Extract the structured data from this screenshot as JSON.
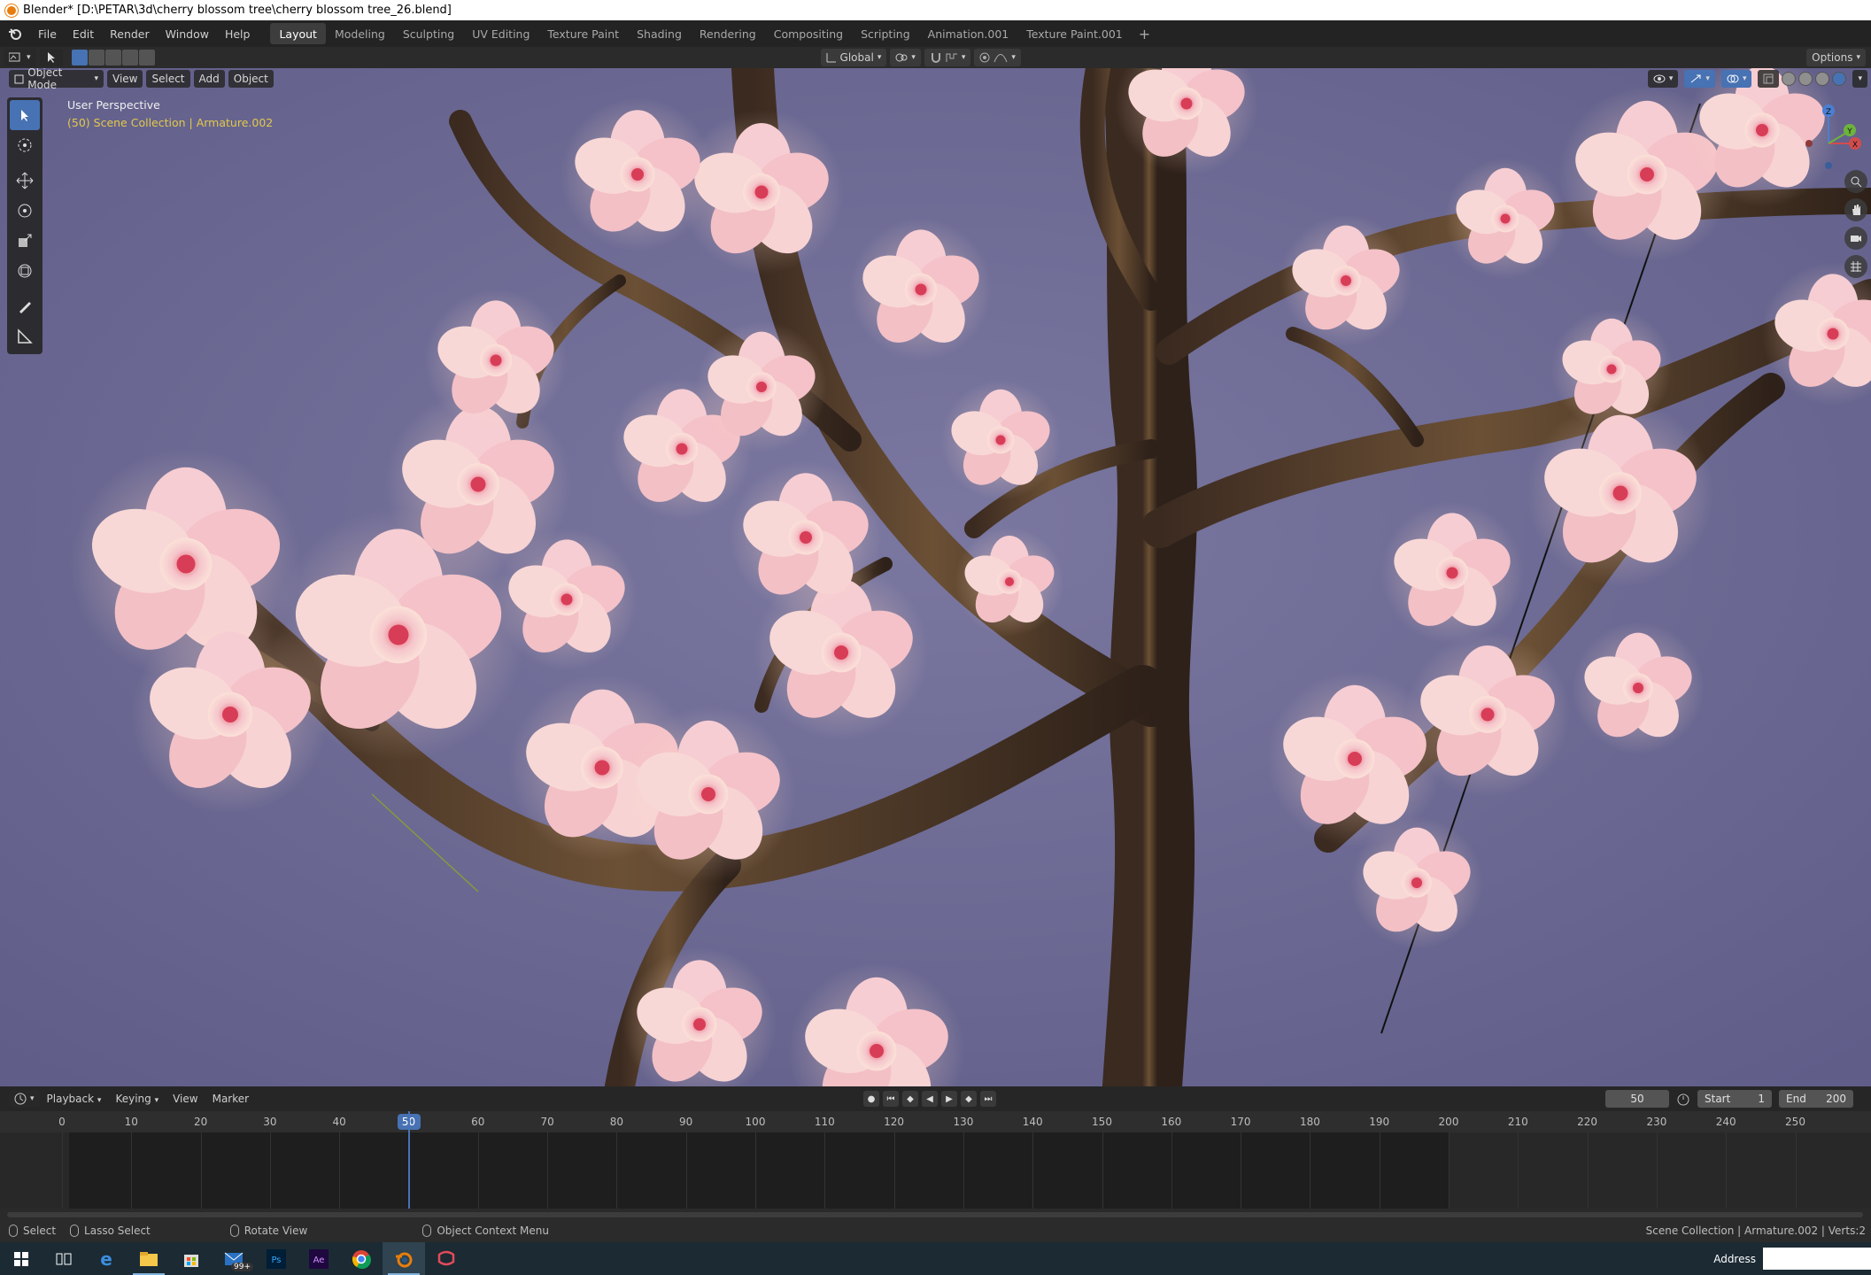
{
  "window": {
    "title": "Blender* [D:\\PETAR\\3d\\cherry blossom tree\\cherry blossom tree_26.blend]"
  },
  "menu": {
    "items": [
      "File",
      "Edit",
      "Render",
      "Window",
      "Help"
    ]
  },
  "workspaces": [
    {
      "label": "Layout",
      "active": true
    },
    {
      "label": "Modeling"
    },
    {
      "label": "Sculpting"
    },
    {
      "label": "UV Editing"
    },
    {
      "label": "Texture Paint"
    },
    {
      "label": "Shading"
    },
    {
      "label": "Rendering"
    },
    {
      "label": "Compositing"
    },
    {
      "label": "Scripting"
    },
    {
      "label": "Animation.001"
    },
    {
      "label": "Texture Paint.001"
    }
  ],
  "header": {
    "orientation": "Global",
    "options": "Options"
  },
  "viewport": {
    "mode": "Object Mode",
    "menus": [
      "View",
      "Select",
      "Add",
      "Object"
    ],
    "perspective": "User Perspective",
    "collection": "(50) Scene Collection | Armature.002",
    "gizmo_axes": {
      "x": "X",
      "y": "Y",
      "z": "Z"
    },
    "colors": {
      "sky": "#6c6a93",
      "bark": "#4a3526",
      "petal": "#f2c7cf",
      "petal_center": "#e2516a",
      "active": "#4772b3"
    },
    "tools": [
      "select-box-icon",
      "cursor-icon",
      "move-icon",
      "rotate-icon",
      "scale-icon",
      "transform-icon",
      "annotate-icon",
      "measure-icon"
    ]
  },
  "timeline": {
    "menus": [
      "Playback",
      "Keying",
      "View",
      "Marker"
    ],
    "current_frame": "50",
    "start_label": "Start",
    "start": "1",
    "end_label": "End",
    "end": "200",
    "ticks": [
      "0",
      "10",
      "20",
      "30",
      "40",
      "50",
      "60",
      "70",
      "80",
      "90",
      "100",
      "110",
      "120",
      "130",
      "140",
      "150",
      "160",
      "170",
      "180",
      "190",
      "200",
      "210",
      "220",
      "230",
      "240",
      "250"
    ]
  },
  "status": {
    "select": "Select",
    "lasso": "Lasso Select",
    "rotate": "Rotate View",
    "context": "Object Context Menu",
    "info": "Scene Collection | Armature.002 | Verts:2"
  },
  "taskbar": {
    "badge": "99+",
    "address_label": "Address",
    "apps": [
      "windows-start-icon",
      "task-view-icon",
      "edge-icon",
      "file-explorer-icon",
      "store-icon",
      "mail-icon",
      "photoshop-icon",
      "after-effects-icon",
      "chrome-icon",
      "blender-icon",
      "app-icon"
    ]
  }
}
